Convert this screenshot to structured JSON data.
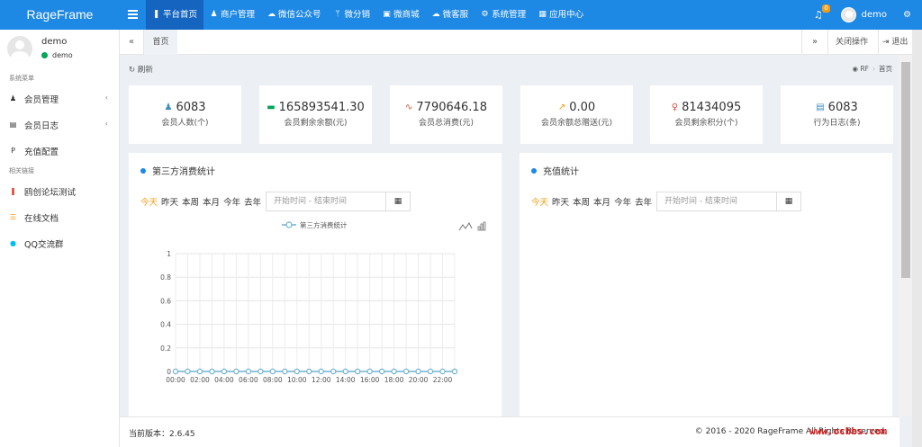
{
  "app": {
    "title": "RageFrame",
    "brand_color": "#1e88e5"
  },
  "topnav": {
    "items": [
      {
        "label": "平台首页",
        "icon": "bookmark-icon",
        "glyph": "❚"
      },
      {
        "label": "商户管理",
        "icon": "users-icon",
        "glyph": "♟"
      },
      {
        "label": "微信公众号",
        "icon": "wechat-icon",
        "glyph": "☁"
      },
      {
        "label": "微分销",
        "icon": "fork-icon",
        "glyph": "ᛘ"
      },
      {
        "label": "微商城",
        "icon": "shop-icon",
        "glyph": "▣"
      },
      {
        "label": "微客服",
        "icon": "chat-icon",
        "glyph": "☁"
      },
      {
        "label": "系统管理",
        "icon": "cogs-icon",
        "glyph": "⚙"
      },
      {
        "label": "应用中心",
        "icon": "apps-icon",
        "glyph": "▦"
      }
    ],
    "notification_count": "0",
    "user": "demo"
  },
  "sidebar": {
    "user_name": "demo",
    "user_status": "demo",
    "section_system": "系统菜单",
    "system_items": [
      {
        "label": "会员管理",
        "icon": "user-icon",
        "glyph": "♟",
        "has_children": true
      },
      {
        "label": "会员日志",
        "icon": "file-icon",
        "glyph": "▤",
        "has_children": true
      },
      {
        "label": "充值配置",
        "icon": "paypal-icon",
        "glyph": "P",
        "has_children": false
      }
    ],
    "section_links": "相关链接",
    "link_items": [
      {
        "label": "鸥创论坛测试",
        "icon": "bookmark-icon",
        "glyph": "❚",
        "color": "#dd4b39"
      },
      {
        "label": "在线文档",
        "icon": "list-icon",
        "glyph": "☰",
        "color": "#f39c12"
      },
      {
        "label": "QQ交流群",
        "icon": "qq-icon",
        "glyph": "●",
        "color": "#00c0ef"
      }
    ]
  },
  "tabs": {
    "prev": "«",
    "home": "首页",
    "next": "»",
    "close_ops": "关闭操作",
    "exit": "退出"
  },
  "toolbar": {
    "refresh": "刷新",
    "breadcrumb_root": "RF",
    "breadcrumb_current": "首页"
  },
  "stats": [
    {
      "value": "6083",
      "label": "会员人数(个)",
      "icon": "users-icon",
      "glyph": "♟",
      "color": "#3c8dbc"
    },
    {
      "value": "165893541.30",
      "label": "会员剩余余额(元)",
      "icon": "credit-card-icon",
      "glyph": "▬",
      "color": "#00a65a"
    },
    {
      "value": "7790646.18",
      "label": "会员总消费(元)",
      "icon": "heartbeat-icon",
      "glyph": "∿",
      "color": "#dd4b39"
    },
    {
      "value": "0.00",
      "label": "会员余额总赠送(元)",
      "icon": "trend-icon",
      "glyph": "↗",
      "color": "#f39c12"
    },
    {
      "value": "81434095",
      "label": "会员剩余积分(个)",
      "icon": "bulb-icon",
      "glyph": "♀",
      "color": "#dd4b39"
    },
    {
      "value": "6083",
      "label": "行为日志(条)",
      "icon": "list-alt-icon",
      "glyph": "▤",
      "color": "#3c8dbc"
    }
  ],
  "panels": {
    "consume": {
      "title": "第三方消费统计",
      "ranges": [
        "今天",
        "昨天",
        "本周",
        "本月",
        "今年",
        "去年"
      ],
      "active_range": "今天",
      "date_placeholder": "开始时间 - 结束时间"
    },
    "recharge": {
      "title": "充值统计",
      "ranges": [
        "今天",
        "昨天",
        "本周",
        "本月",
        "今年",
        "去年"
      ],
      "active_range": "今天",
      "date_placeholder": "开始时间 - 结束时间"
    }
  },
  "chart_data": {
    "type": "line",
    "legend": "第三方消费统计",
    "x": [
      "00:00",
      "01:00",
      "02:00",
      "03:00",
      "04:00",
      "05:00",
      "06:00",
      "07:00",
      "08:00",
      "09:00",
      "10:00",
      "11:00",
      "12:00",
      "13:00",
      "14:00",
      "15:00",
      "16:00",
      "17:00",
      "18:00",
      "19:00",
      "20:00",
      "21:00",
      "22:00",
      "23:00"
    ],
    "x_tick_labels": [
      "00:00",
      "02:00",
      "04:00",
      "06:00",
      "08:00",
      "10:00",
      "12:00",
      "14:00",
      "16:00",
      "18:00",
      "20:00",
      "22:00"
    ],
    "series": [
      {
        "name": "第三方消费统计",
        "values": [
          0,
          0,
          0,
          0,
          0,
          0,
          0,
          0,
          0,
          0,
          0,
          0,
          0,
          0,
          0,
          0,
          0,
          0,
          0,
          0,
          0,
          0,
          0,
          0
        ]
      }
    ],
    "ylim": [
      0,
      1
    ],
    "y_ticks": [
      "0",
      "0.2",
      "0.4",
      "0.6",
      "0.8",
      "1"
    ],
    "grid": true,
    "line_color": "#6fb3d2"
  },
  "footer": {
    "version": "当前版本：2.6.45",
    "copyright": "© 2016 - 2020 RageFrame All Rights Reserved."
  },
  "watermark": "www.ocbbs.com"
}
